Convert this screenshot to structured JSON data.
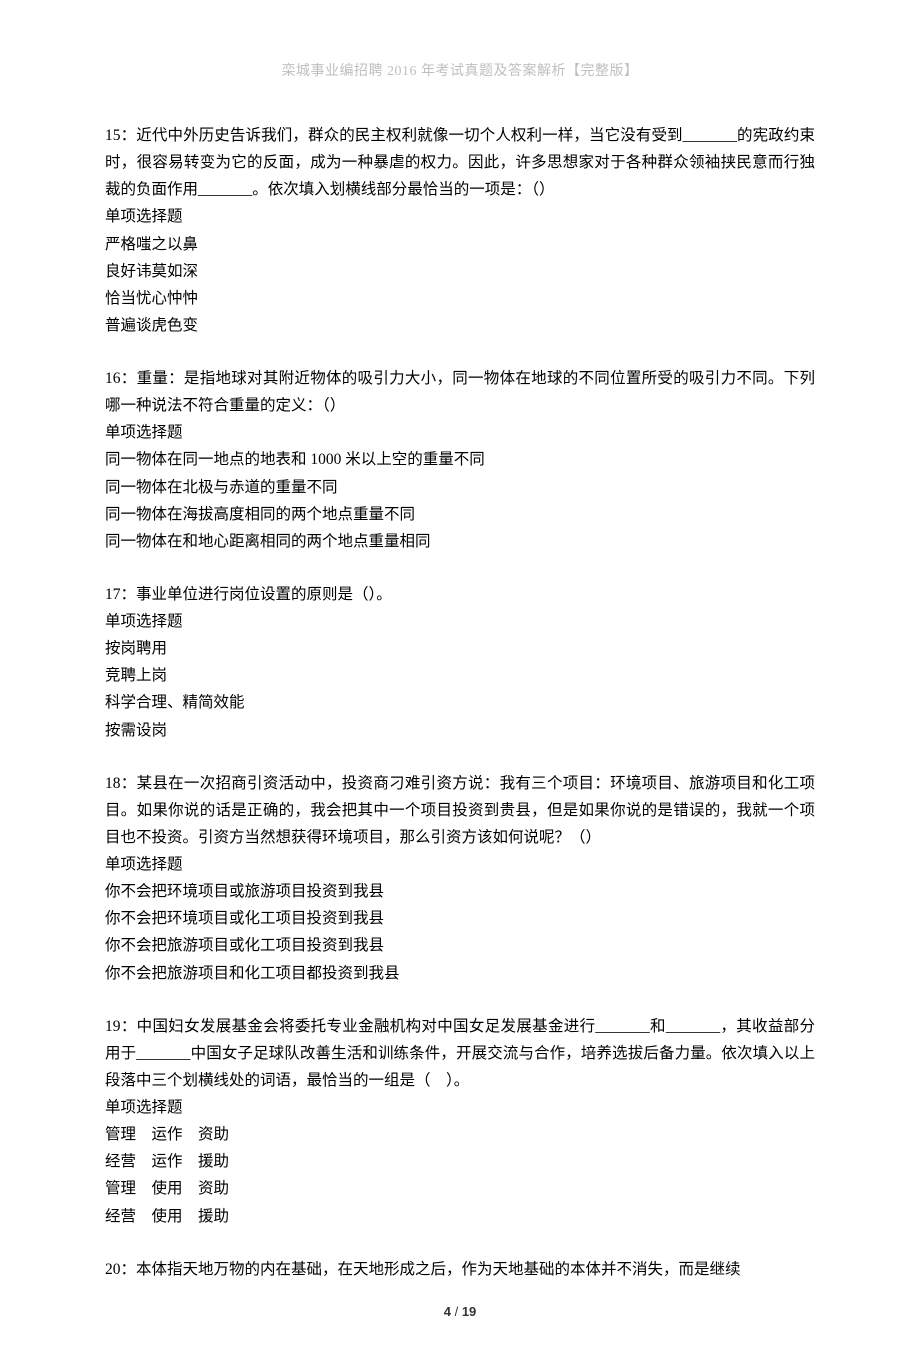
{
  "header": "栾城事业编招聘 2016 年考试真题及答案解析【完整版】",
  "questions": [
    {
      "stem": "15：近代中外历史告诉我们，群众的民主权利就像一切个人权利一样，当它没有受到_______的宪政约束时，很容易转变为它的反面，成为一种暴虐的权力。因此，许多思想家对于各种群众领袖挟民意而行独裁的负面作用_______。依次填入划横线部分最恰当的一项是：（）",
      "type": "单项选择题",
      "options": [
        "严格嗤之以鼻",
        "良好讳莫如深",
        "恰当忧心忡忡",
        "普遍谈虎色变"
      ]
    },
    {
      "stem": "16：重量：是指地球对其附近物体的吸引力大小，同一物体在地球的不同位置所受的吸引力不同。下列哪一种说法不符合重量的定义：（）",
      "type": "单项选择题",
      "options": [
        "同一物体在同一地点的地表和 1000 米以上空的重量不同",
        "同一物体在北极与赤道的重量不同",
        "同一物体在海拔高度相同的两个地点重量不同",
        "同一物体在和地心距离相同的两个地点重量相同"
      ]
    },
    {
      "stem": "17：事业单位进行岗位设置的原则是（）。",
      "type": "单项选择题",
      "options": [
        "按岗聘用",
        "竞聘上岗",
        "科学合理、精简效能",
        "按需设岗"
      ]
    },
    {
      "stem": "18：某县在一次招商引资活动中，投资商刁难引资方说：我有三个项目：环境项目、旅游项目和化工项目。如果你说的话是正确的，我会把其中一个项目投资到贵县，但是如果你说的是错误的，我就一个项目也不投资。引资方当然想获得环境项目，那么引资方该如何说呢？（）",
      "type": "单项选择题",
      "options": [
        "你不会把环境项目或旅游项目投资到我县",
        "你不会把环境项目或化工项目投资到我县",
        "你不会把旅游项目或化工项目投资到我县",
        "你不会把旅游项目和化工项目都投资到我县"
      ]
    },
    {
      "stem": "19：中国妇女发展基金会将委托专业金融机构对中国女足发展基金进行_______和_______，其收益部分用于_______中国女子足球队改善生活和训练条件，开展交流与合作，培养选拔后备力量。依次填入以上段落中三个划横线处的词语，最恰当的一组是（　）。",
      "type": "单项选择题",
      "options": [
        "管理　运作　资助",
        "经营　运作　援助",
        "管理　使用　资助",
        "经营　使用　援助"
      ]
    },
    {
      "stem": "20：本体指天地万物的内在基础，在天地形成之后，作为天地基础的本体并不消失，而是继续",
      "type": "",
      "options": []
    }
  ],
  "footer": {
    "current": "4",
    "total": "19"
  }
}
